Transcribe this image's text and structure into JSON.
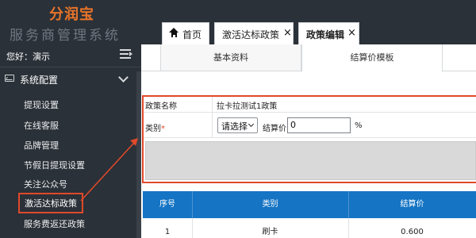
{
  "brand": {
    "title": "分润宝",
    "subtitle": "服务商管理系统"
  },
  "user": {
    "greeting": "您好：",
    "name": "演示"
  },
  "sidebar": {
    "section_title": "系统配置",
    "items": [
      {
        "label": "提现设置"
      },
      {
        "label": "在线客服"
      },
      {
        "label": "品牌管理"
      },
      {
        "label": "节假日提现设置"
      },
      {
        "label": "关注公众号"
      },
      {
        "label": "激活达标政策",
        "active": true
      },
      {
        "label": "服务费返还政策"
      }
    ]
  },
  "tabs": [
    {
      "label": "首页",
      "icon": "home-icon",
      "closable": false
    },
    {
      "label": "激活达标政策",
      "closable": true
    },
    {
      "label": "政策编辑",
      "closable": true,
      "active": true
    }
  ],
  "close_glyph": "×",
  "subtabs": [
    {
      "label": "基本资料"
    },
    {
      "label": "结算价模板",
      "active": true
    }
  ],
  "form": {
    "policy_name_label": "政策名称",
    "policy_name_value": "拉卡拉测试1政策",
    "category_label": "类别",
    "required_mark": "*",
    "category_select": "请选择",
    "price_label": "结算价",
    "price_value": "0",
    "price_unit": "%"
  },
  "table": {
    "headers": [
      "序号",
      "类别",
      "结算价"
    ],
    "rows": [
      [
        "1",
        "刷卡",
        "0.600"
      ]
    ]
  },
  "colors": {
    "sidebar_bg": "#2b3138",
    "brand_orange": "#e8742a",
    "highlight_red": "#e0492b",
    "table_header_blue": "#1574c4"
  }
}
